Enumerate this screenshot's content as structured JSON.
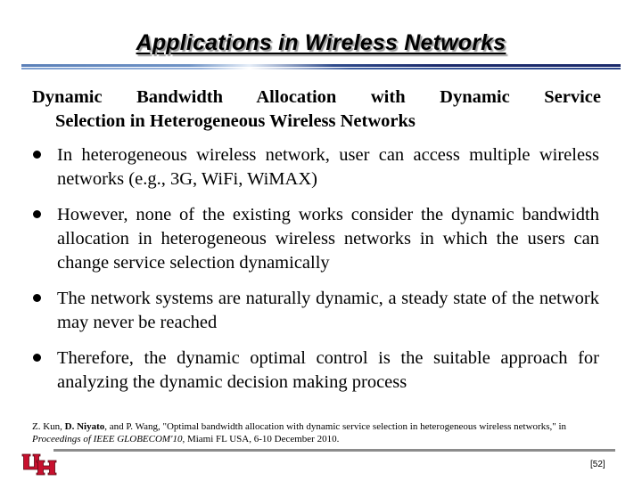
{
  "slide": {
    "title": "Applications in Wireless Networks",
    "heading": {
      "line1": "Dynamic Bandwidth Allocation with Dynamic Service",
      "line2": "Selection in Heterogeneous Wireless Networks"
    },
    "bullets": [
      {
        "text": "In heterogeneous wireless network, user can access multiple wireless networks (e.g., 3G, WiFi, WiMAX)"
      },
      {
        "text": "However, none of the existing works consider the dynamic bandwidth allocation in heterogeneous wireless networks in which the users can change service selection dynamically"
      },
      {
        "text": "The network systems are naturally dynamic, a steady state of the network may never be reached"
      },
      {
        "text": "Therefore, the dynamic optimal control is the suitable approach for analyzing the dynamic decision making process"
      }
    ],
    "reference": {
      "author1": "Z. Kun, ",
      "author2_bold": "D. Niyato",
      "author3": ", and P. Wang, \"Optimal bandwidth allocation with dynamic service selection in heterogeneous wireless networks,\" in ",
      "venue_italic": "Proceedings of IEEE GLOBECOM'10",
      "tail": ", Miami FL USA, 6-10 December 2010."
    },
    "logo": {
      "icon": "uh-logo-icon",
      "text": "UH",
      "color": "#c8102e"
    },
    "page_number": "[52]"
  }
}
